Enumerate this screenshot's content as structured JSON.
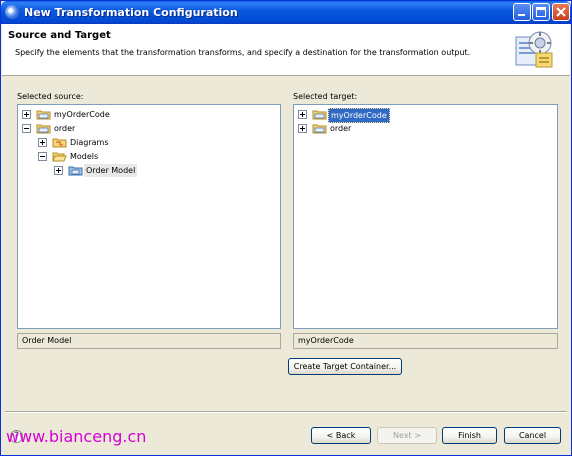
{
  "window": {
    "title": "New Transformation Configuration"
  },
  "banner": {
    "title": "Source and Target",
    "description": "Specify the elements that the transformation transforms, and specify a destination for the transformation output.",
    "graphic_icon": "wizard-config-icon"
  },
  "source": {
    "label": "Selected source:",
    "tree": [
      {
        "label": "myOrderCode",
        "expander": "plus",
        "icon": "project-folder-icon"
      },
      {
        "label": "order",
        "expander": "minus",
        "icon": "project-folder-icon"
      },
      {
        "label": "Diagrams",
        "expander": "plus",
        "icon": "folder-icon"
      },
      {
        "label": "Models",
        "expander": "minus",
        "icon": "folder-open-icon"
      },
      {
        "label": "Order Model",
        "expander": "plus",
        "icon": "model-icon",
        "highlighted": true
      }
    ],
    "selection_text": "Order Model"
  },
  "target": {
    "label": "Selected target:",
    "tree": [
      {
        "label": "myOrderCode",
        "expander": "plus",
        "icon": "project-folder-icon",
        "selected": true
      },
      {
        "label": "order",
        "expander": "plus",
        "icon": "project-folder-icon"
      }
    ],
    "selection_text": "myOrderCode",
    "create_button": "Create Target Container..."
  },
  "buttons": {
    "back": "< Back",
    "next": "Next >",
    "finish": "Finish",
    "cancel": "Cancel"
  },
  "help_icon": "help-icon",
  "watermark": "www.bianceng.cn",
  "colors": {
    "titlebar": "#0a5ae0",
    "selection": "#316ac5",
    "dialog_bg": "#ece9d8",
    "watermark": "#d600d6"
  }
}
